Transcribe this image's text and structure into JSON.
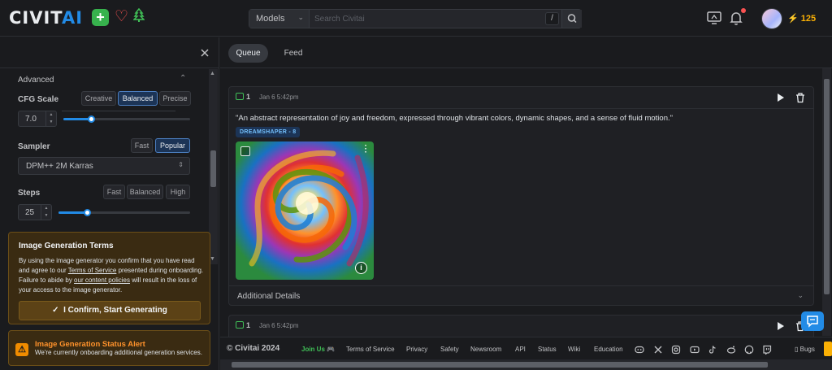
{
  "header": {
    "logo_main": "CIVIT",
    "logo_accent": "AI",
    "search": {
      "scope": "Models",
      "placeholder": "Search Civitai",
      "shortcut": "/"
    },
    "buzz_amount": "125"
  },
  "sidebar": {
    "section_title": "Advanced",
    "cfg": {
      "label": "CFG Scale",
      "presets": [
        "Creative",
        "Balanced",
        "Precise"
      ],
      "active": "Balanced",
      "value": "7.0",
      "slider_fraction": 0.22
    },
    "sampler": {
      "label": "Sampler",
      "presets": [
        "Fast",
        "Popular"
      ],
      "active": "Popular",
      "value": "DPM++ 2M Karras"
    },
    "steps": {
      "label": "Steps",
      "presets": [
        "Fast",
        "Balanced",
        "High"
      ],
      "active": "",
      "value": "25",
      "slider_fraction": 0.2
    },
    "terms": {
      "title": "Image Generation Terms",
      "text_1": "By using the image generator you confirm that you have read and agree to our ",
      "link_1": "Terms of Service",
      "text_2": " presented during onboarding. Failure to abide by ",
      "link_2": "our content policies",
      "text_3": " will result in the loss of your access to the image generator.",
      "confirm_label": "I Confirm, Start Generating"
    },
    "alert": {
      "title": "Image Generation Status Alert",
      "text": "We're currently onboarding additional generation services."
    }
  },
  "main": {
    "tabs": [
      "Queue",
      "Feed"
    ],
    "active_tab": "Queue",
    "cards": [
      {
        "count": "1",
        "date": "Jan 6 5:42pm",
        "prompt": "\"An abstract representation of joy and freedom, expressed through vibrant colors, dynamic shapes, and a sense of fluid motion.\"",
        "model": "DREAMSHAPER - 8",
        "details_label": "Additional Details"
      },
      {
        "count": "1",
        "date": "Jan 6 5:42pm"
      }
    ]
  },
  "footer": {
    "copyright": "© Civitai 2024",
    "join": "Join Us 🎮",
    "links": [
      "Terms of Service",
      "Privacy",
      "Safety",
      "Newsroom",
      "API",
      "Status",
      "Wiki",
      "Education"
    ],
    "bugs": "Bugs"
  },
  "colors": {
    "accent": "#228be6",
    "buzz": "#fab005",
    "warning_bg": "#3a2b12",
    "success": "#40c057"
  }
}
